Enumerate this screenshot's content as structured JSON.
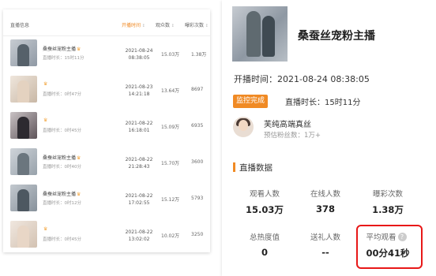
{
  "list": {
    "headers": {
      "info": "直播信息",
      "start": "开播时间",
      "viewers": "观众数",
      "likes": "曝彩次数"
    },
    "rows": [
      {
        "name": "桑蚕丝宠粉主播",
        "duration": "直播时长：15时11分",
        "date": "2021-08-24",
        "clock": "08:38:05",
        "viewers": "15.03万",
        "likes": "1.38万"
      },
      {
        "name": "",
        "duration": "直播时长：0时47分",
        "date": "2021-08-23",
        "clock": "14:21:18",
        "viewers": "13.64万",
        "likes": "8697"
      },
      {
        "name": "",
        "duration": "直播时长：0时45分",
        "date": "2021-08-22",
        "clock": "16:18:01",
        "viewers": "15.09万",
        "likes": "6935"
      },
      {
        "name": "桑蚕丝宠粉主播",
        "duration": "直播时长：0时40分",
        "date": "2021-08-22",
        "clock": "21:28:43",
        "viewers": "15.70万",
        "likes": "3600"
      },
      {
        "name": "桑蚕丝宠粉主播",
        "duration": "直播时长：0时12分",
        "date": "2021-08-22",
        "clock": "17:02:55",
        "viewers": "15.12万",
        "likes": "5793"
      },
      {
        "name": "",
        "duration": "直播时长：0时45分",
        "date": "2021-08-22",
        "clock": "13:02:02",
        "viewers": "10.02万",
        "likes": "3250"
      }
    ]
  },
  "detail": {
    "streamer_name": "桑蚕丝宠粉主播",
    "start_time": "开播时间：2021-08-24 08:38:05",
    "status_badge": "监控完成",
    "duration": "直播时长：15时11分",
    "fan_name": "芙纯高端真丝",
    "fan_count": "预估粉丝数：1万+",
    "section_title": "直播数据",
    "stats": [
      {
        "label": "观看人数",
        "value": "15.03万"
      },
      {
        "label": "在线人数",
        "value": "378"
      },
      {
        "label": "曝彩次数",
        "value": "1.38万"
      },
      {
        "label": "总热度值",
        "value": "0"
      },
      {
        "label": "送礼人数",
        "value": "--"
      },
      {
        "label": "平均观看",
        "value": "00分41秒"
      }
    ]
  },
  "colors": {
    "accent": "#f08a24",
    "highlight": "#e81818",
    "crown": "#f2a33a"
  },
  "icons": {
    "crown": "crown-icon",
    "help": "question-icon",
    "sort": "sort-icon"
  }
}
